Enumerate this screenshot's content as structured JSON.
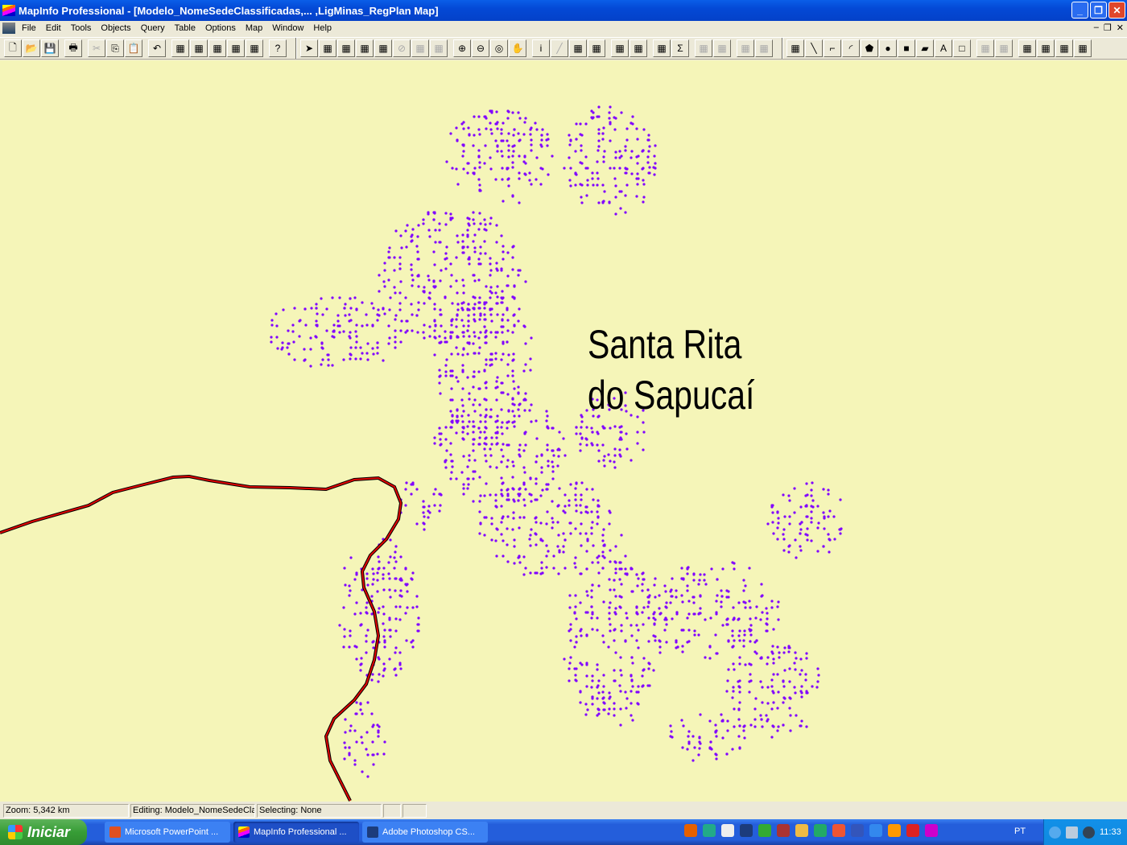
{
  "window": {
    "title": "MapInfo Professional - [Modelo_NomeSedeClassificadas,... ,LigMinas_RegPlan Map]",
    "controls": [
      "minimize",
      "restore",
      "close"
    ]
  },
  "menu": {
    "items": [
      "File",
      "Edit",
      "Tools",
      "Objects",
      "Query",
      "Table",
      "Options",
      "Map",
      "Window",
      "Help"
    ]
  },
  "toolbar": {
    "groups": [
      [
        "new-icon",
        "open-icon",
        "save-icon"
      ],
      [
        "print-icon"
      ],
      [
        "cut-icon",
        "copy-icon",
        "paste-icon"
      ],
      [
        "undo-icon"
      ],
      [
        "new-browser-icon",
        "new-mapper-icon",
        "new-grapher-icon",
        "new-layout-icon",
        "redistrict-icon"
      ],
      [
        "help-pointer-icon"
      ],
      "|",
      [
        "select-icon",
        "marquee-select-icon",
        "radius-select-icon",
        "polygon-select-icon",
        "boundary-select-icon",
        "unselect-icon",
        "invert-select-icon",
        "graph-select-icon"
      ],
      [
        "zoom-in-icon",
        "zoom-out-icon",
        "change-view-icon",
        "grabber-icon"
      ],
      [
        "info-icon",
        "ruler-icon",
        "label-icon",
        "drag-window-icon"
      ],
      [
        "layer-control-icon",
        "legend-icon"
      ],
      [
        "statistics-icon",
        "sigma-icon"
      ],
      [
        "hotlink-icon",
        "clip-icon"
      ],
      [
        "show-icon",
        "hide-icon"
      ],
      "|",
      [
        "symbol-icon",
        "line-icon",
        "polyline-icon",
        "arc-icon",
        "polygon-icon",
        "ellipse-icon",
        "rectangle-icon",
        "rounded-rect-icon",
        "text-icon",
        "frame-icon"
      ],
      [
        "reshape-icon",
        "add-node-icon"
      ],
      [
        "line-style-icon",
        "region-style-icon",
        "symbol-style-icon",
        "text-style-icon"
      ]
    ]
  },
  "map": {
    "label_line1": "Santa Rita",
    "label_line2": "do Sapucaí",
    "point_color": "#8000ff",
    "road_color": "#e00000",
    "background": "#f5f5b8"
  },
  "status": {
    "zoom": "Zoom: 5,342 km",
    "editing": "Editing: Modelo_NomeSedeClas",
    "selecting": "Selecting: None",
    "extra1": "",
    "extra2": ""
  },
  "taskbar": {
    "start_label": "Iniciar",
    "tasks": [
      {
        "label": "Microsoft PowerPoint ...",
        "color": "#e05020",
        "active": false
      },
      {
        "label": "MapInfo Professional ...",
        "color": "#e020e0",
        "active": true
      },
      {
        "label": "Adobe Photoshop CS...",
        "color": "#1c3c7c",
        "active": false
      }
    ],
    "quicklaunch": [
      {
        "name": "firefox-icon",
        "color": "#e66000"
      },
      {
        "name": "network-icon",
        "color": "#2a8"
      },
      {
        "name": "window-icon",
        "color": "#eee"
      },
      {
        "name": "photoshop-icon",
        "color": "#1c3c7c"
      },
      {
        "name": "corel-icon",
        "color": "#3a3"
      },
      {
        "name": "access-icon",
        "color": "#a33"
      },
      {
        "name": "outlook-icon",
        "color": "#eb4"
      },
      {
        "name": "excel-icon",
        "color": "#2a6"
      },
      {
        "name": "powerpoint-icon",
        "color": "#e53"
      },
      {
        "name": "word-icon",
        "color": "#35b"
      },
      {
        "name": "ie-icon",
        "color": "#38e"
      },
      {
        "name": "media-player-icon",
        "color": "#f90"
      },
      {
        "name": "acrobat-icon",
        "color": "#d22"
      },
      {
        "name": "mapinfo-icon",
        "color": "#c0c"
      }
    ],
    "language": "PT",
    "clock": "11:33"
  }
}
